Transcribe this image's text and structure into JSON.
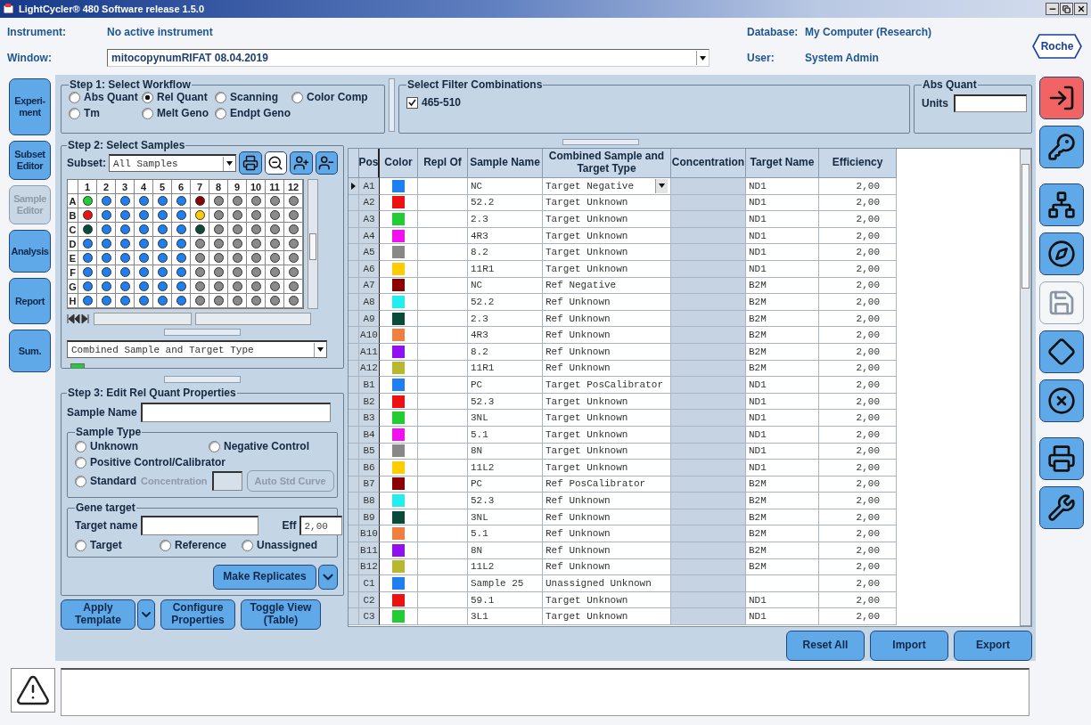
{
  "title_bar": {
    "title": "LightCycler® 480 Software release 1.5.0"
  },
  "header": {
    "instrument": {
      "label": "Instrument:",
      "value": "No active instrument"
    },
    "database": {
      "label": "Database:",
      "value": "My Computer (Research)"
    },
    "window": {
      "label": "Window:",
      "value": "mitocopynumRIFAT 08.04.2019"
    },
    "user": {
      "label": "User:",
      "value": "System Admin"
    },
    "logo": "Roche"
  },
  "left_nav": [
    {
      "label": "Experi-\nment",
      "disabled": false
    },
    {
      "label": "Subset\nEditor",
      "disabled": false
    },
    {
      "label": "Sample\nEditor",
      "disabled": true
    },
    {
      "label": "Analysis",
      "disabled": false
    },
    {
      "label": "Report",
      "disabled": false
    },
    {
      "label": "Sum.",
      "disabled": false
    }
  ],
  "step1": {
    "title": "Step 1: Select Workflow",
    "options": [
      {
        "label": "Abs Quant",
        "selected": false
      },
      {
        "label": "Rel Quant",
        "selected": true
      },
      {
        "label": "Scanning",
        "selected": false
      },
      {
        "label": "Color Comp",
        "selected": false
      },
      {
        "label": "Tm",
        "selected": false
      },
      {
        "label": "Melt Geno",
        "selected": false
      },
      {
        "label": "Endpt Geno",
        "selected": false
      }
    ]
  },
  "filters": {
    "title": "Select Filter Combinations",
    "items": [
      {
        "label": "465-510",
        "checked": true
      }
    ]
  },
  "abs_quant": {
    "title": "Abs Quant",
    "units_label": "Units"
  },
  "step2": {
    "title": "Step 2: Select Samples",
    "subset_label": "Subset:",
    "subset_value": "All Samples",
    "tools": [
      {
        "kind": "print",
        "pressed": false
      },
      {
        "kind": "zoom_out",
        "pressed": true
      },
      {
        "kind": "add_user",
        "pressed": false
      },
      {
        "kind": "remove_user",
        "pressed": false
      }
    ],
    "plate": {
      "columns": [
        "1",
        "2",
        "3",
        "4",
        "5",
        "6",
        "7",
        "8",
        "9",
        "10",
        "11",
        "12"
      ],
      "rows": [
        {
          "label": "A",
          "wells": [
            {
              "color": "#22cc33"
            },
            {
              "color": "#1e7ff0"
            },
            {
              "color": "#1e7ff0"
            },
            {
              "color": "#1e7ff0"
            },
            {
              "color": "#1e7ff0"
            },
            {
              "color": "#1e7ff0"
            },
            {
              "color": "#8b0000"
            },
            {
              "color": "#8a8a8a"
            },
            {
              "color": "#8a8a8a"
            },
            {
              "color": "#8a8a8a"
            },
            {
              "color": "#8a8a8a"
            },
            {
              "color": "#8a8a8a"
            }
          ]
        },
        {
          "label": "B",
          "wells": [
            {
              "color": "#ee1111"
            },
            {
              "color": "#1e7ff0"
            },
            {
              "color": "#1e7ff0"
            },
            {
              "color": "#1e7ff0"
            },
            {
              "color": "#1e7ff0"
            },
            {
              "color": "#1e7ff0"
            },
            {
              "color": "#ffcc00"
            },
            {
              "color": "#8a8a8a"
            },
            {
              "color": "#8a8a8a"
            },
            {
              "color": "#8a8a8a"
            },
            {
              "color": "#8a8a8a"
            },
            {
              "color": "#8a8a8a"
            }
          ]
        },
        {
          "label": "C",
          "wells": [
            {
              "color": "#0a4a3a"
            },
            {
              "color": "#1e7ff0"
            },
            {
              "color": "#1e7ff0"
            },
            {
              "color": "#1e7ff0"
            },
            {
              "color": "#1e7ff0"
            },
            {
              "color": "#1e7ff0"
            },
            {
              "color": "#0a4a3a"
            },
            {
              "color": "#8a8a8a"
            },
            {
              "color": "#8a8a8a"
            },
            {
              "color": "#8a8a8a"
            },
            {
              "color": "#8a8a8a"
            },
            {
              "color": "#8a8a8a"
            }
          ]
        },
        {
          "label": "D",
          "wells": [
            {
              "color": "#1e7ff0"
            },
            {
              "color": "#1e7ff0"
            },
            {
              "color": "#1e7ff0"
            },
            {
              "color": "#1e7ff0"
            },
            {
              "color": "#1e7ff0"
            },
            {
              "color": "#1e7ff0"
            },
            {
              "color": "#8a8a8a"
            },
            {
              "color": "#8a8a8a"
            },
            {
              "color": "#8a8a8a"
            },
            {
              "color": "#8a8a8a"
            },
            {
              "color": "#8a8a8a"
            },
            {
              "color": "#8a8a8a"
            }
          ]
        },
        {
          "label": "E",
          "wells": [
            {
              "color": "#1e7ff0"
            },
            {
              "color": "#1e7ff0"
            },
            {
              "color": "#1e7ff0"
            },
            {
              "color": "#1e7ff0"
            },
            {
              "color": "#1e7ff0"
            },
            {
              "color": "#1e7ff0"
            },
            {
              "color": "#8a8a8a"
            },
            {
              "color": "#8a8a8a"
            },
            {
              "color": "#8a8a8a"
            },
            {
              "color": "#8a8a8a"
            },
            {
              "color": "#8a8a8a"
            },
            {
              "color": "#8a8a8a"
            }
          ]
        },
        {
          "label": "F",
          "wells": [
            {
              "color": "#1e7ff0"
            },
            {
              "color": "#1e7ff0"
            },
            {
              "color": "#1e7ff0"
            },
            {
              "color": "#1e7ff0"
            },
            {
              "color": "#1e7ff0"
            },
            {
              "color": "#1e7ff0"
            },
            {
              "color": "#8a8a8a"
            },
            {
              "color": "#8a8a8a"
            },
            {
              "color": "#8a8a8a"
            },
            {
              "color": "#8a8a8a"
            },
            {
              "color": "#8a8a8a"
            },
            {
              "color": "#8a8a8a"
            }
          ]
        },
        {
          "label": "G",
          "wells": [
            {
              "color": "#1e7ff0"
            },
            {
              "color": "#1e7ff0"
            },
            {
              "color": "#1e7ff0"
            },
            {
              "color": "#1e7ff0"
            },
            {
              "color": "#1e7ff0"
            },
            {
              "color": "#1e7ff0"
            },
            {
              "color": "#8a8a8a"
            },
            {
              "color": "#8a8a8a"
            },
            {
              "color": "#8a8a8a"
            },
            {
              "color": "#8a8a8a"
            },
            {
              "color": "#8a8a8a"
            },
            {
              "color": "#8a8a8a"
            }
          ]
        },
        {
          "label": "H",
          "wells": [
            {
              "color": "#1e7ff0"
            },
            {
              "color": "#1e7ff0"
            },
            {
              "color": "#1e7ff0"
            },
            {
              "color": "#1e7ff0"
            },
            {
              "color": "#1e7ff0"
            },
            {
              "color": "#1e7ff0"
            },
            {
              "color": "#8a8a8a"
            },
            {
              "color": "#8a8a8a"
            },
            {
              "color": "#8a8a8a"
            },
            {
              "color": "#8a8a8a"
            },
            {
              "color": "#8a8a8a"
            },
            {
              "color": "#8a8a8a"
            }
          ]
        }
      ]
    },
    "display_select": "Combined Sample and Target Type",
    "legend": [
      {
        "color": "#22cc33"
      }
    ]
  },
  "step3": {
    "title": "Step 3: Edit Rel Quant Properties",
    "sample_name_label": "Sample Name",
    "sample_type": {
      "title": "Sample Type",
      "options": [
        {
          "label": "Unknown",
          "selected": false
        },
        {
          "label": "Negative Control",
          "selected": false
        },
        {
          "label": "Positive Control/Calibrator",
          "selected": false
        },
        {
          "label": "Standard",
          "selected": false
        }
      ],
      "concentration_label": "Concentration",
      "auto_button": "Auto Std Curve",
      "concentration_disabled": true
    },
    "gene_target": {
      "title": "Gene target",
      "target_label": "Target name",
      "eff_label": "Eff",
      "eff_value": "2,00",
      "options": [
        {
          "label": "Target",
          "selected": false
        },
        {
          "label": "Reference",
          "selected": false
        },
        {
          "label": "Unassigned",
          "selected": false
        }
      ]
    },
    "replicates_button": "Make Replicates"
  },
  "left_buttons": [
    {
      "label": "Apply\nTemplate",
      "kind": "split"
    },
    {
      "label": "Configure\nProperties",
      "kind": "plain"
    },
    {
      "label": "Toggle View\n(Table)",
      "kind": "plain"
    }
  ],
  "table": {
    "columns": [
      "Pos",
      "Color",
      "Repl Of",
      "Sample Name",
      "Combined Sample and Target Type",
      "Concentration",
      "Target Name",
      "Efficiency"
    ],
    "rows": [
      {
        "pos": "A1",
        "color": "#1e7ff0",
        "sample_name": "NC",
        "type": "Target Negative",
        "target": "ND1",
        "efficiency": "2,00",
        "selected": true
      },
      {
        "pos": "A2",
        "color": "#ee1111",
        "sample_name": "52.2",
        "type": "Target Unknown",
        "target": "ND1",
        "efficiency": "2,00",
        "selected": false
      },
      {
        "pos": "A3",
        "color": "#22cc33",
        "sample_name": "2.3",
        "type": "Target Unknown",
        "target": "ND1",
        "efficiency": "2,00",
        "selected": false
      },
      {
        "pos": "A4",
        "color": "#f010f0",
        "sample_name": "4R3",
        "type": "Target Unknown",
        "target": "ND1",
        "efficiency": "2,00",
        "selected": false
      },
      {
        "pos": "A5",
        "color": "#888888",
        "sample_name": "8.2",
        "type": "Target Unknown",
        "target": "ND1",
        "efficiency": "2,00",
        "selected": false
      },
      {
        "pos": "A6",
        "color": "#ffcc00",
        "sample_name": "11R1",
        "type": "Target Unknown",
        "target": "ND1",
        "efficiency": "2,00",
        "selected": false
      },
      {
        "pos": "A7",
        "color": "#8b0000",
        "sample_name": "NC",
        "type": "Ref Negative",
        "target": "B2M",
        "efficiency": "2,00",
        "selected": false
      },
      {
        "pos": "A8",
        "color": "#22eeee",
        "sample_name": "52.2",
        "type": "Ref Unknown",
        "target": "B2M",
        "efficiency": "2,00",
        "selected": false
      },
      {
        "pos": "A9",
        "color": "#0a4a3a",
        "sample_name": "2.3",
        "type": "Ref Unknown",
        "target": "B2M",
        "efficiency": "2,00",
        "selected": false
      },
      {
        "pos": "A10",
        "color": "#f08040",
        "sample_name": "4R3",
        "type": "Ref Unknown",
        "target": "B2M",
        "efficiency": "2,00",
        "selected": false
      },
      {
        "pos": "A11",
        "color": "#9010f0",
        "sample_name": "8.2",
        "type": "Ref Unknown",
        "target": "B2M",
        "efficiency": "2,00",
        "selected": false
      },
      {
        "pos": "A12",
        "color": "#b8b830",
        "sample_name": "11R1",
        "type": "Ref Unknown",
        "target": "B2M",
        "efficiency": "2,00",
        "selected": false
      },
      {
        "pos": "B1",
        "color": "#1e7ff0",
        "sample_name": "PC",
        "type": "Target PosCalibrator",
        "target": "ND1",
        "efficiency": "2,00",
        "selected": false
      },
      {
        "pos": "B2",
        "color": "#ee1111",
        "sample_name": "52.3",
        "type": "Target Unknown",
        "target": "ND1",
        "efficiency": "2,00",
        "selected": false
      },
      {
        "pos": "B3",
        "color": "#22cc33",
        "sample_name": "3NL",
        "type": "Target Unknown",
        "target": "ND1",
        "efficiency": "2,00",
        "selected": false
      },
      {
        "pos": "B4",
        "color": "#f010f0",
        "sample_name": "5.1",
        "type": "Target Unknown",
        "target": "ND1",
        "efficiency": "2,00",
        "selected": false
      },
      {
        "pos": "B5",
        "color": "#888888",
        "sample_name": "8N",
        "type": "Target Unknown",
        "target": "ND1",
        "efficiency": "2,00",
        "selected": false
      },
      {
        "pos": "B6",
        "color": "#ffcc00",
        "sample_name": "11L2",
        "type": "Target Unknown",
        "target": "ND1",
        "efficiency": "2,00",
        "selected": false
      },
      {
        "pos": "B7",
        "color": "#8b0000",
        "sample_name": "PC",
        "type": "Ref PosCalibrator",
        "target": "B2M",
        "efficiency": "2,00",
        "selected": false
      },
      {
        "pos": "B8",
        "color": "#22eeee",
        "sample_name": "52.3",
        "type": "Ref Unknown",
        "target": "B2M",
        "efficiency": "2,00",
        "selected": false
      },
      {
        "pos": "B9",
        "color": "#0a4a3a",
        "sample_name": "3NL",
        "type": "Ref Unknown",
        "target": "B2M",
        "efficiency": "2,00",
        "selected": false
      },
      {
        "pos": "B10",
        "color": "#f08040",
        "sample_name": "5.1",
        "type": "Ref Unknown",
        "target": "B2M",
        "efficiency": "2,00",
        "selected": false
      },
      {
        "pos": "B11",
        "color": "#9010f0",
        "sample_name": "8N",
        "type": "Ref Unknown",
        "target": "B2M",
        "efficiency": "2,00",
        "selected": false
      },
      {
        "pos": "B12",
        "color": "#b8b830",
        "sample_name": "11L2",
        "type": "Ref Unknown",
        "target": "B2M",
        "efficiency": "2,00",
        "selected": false
      },
      {
        "pos": "C1",
        "color": "#1e7ff0",
        "sample_name": "Sample 25",
        "type": "Unassigned Unknown",
        "efficiency": "2,00",
        "selected": false
      },
      {
        "pos": "C2",
        "color": "#ee1111",
        "sample_name": "59.1",
        "type": "Target Unknown",
        "target": "ND1",
        "efficiency": "2,00",
        "selected": false
      },
      {
        "pos": "C3",
        "color": "#22cc33",
        "sample_name": "3L1",
        "type": "Target Unknown",
        "target": "ND1",
        "efficiency": "2,00",
        "selected": false
      }
    ]
  },
  "right_buttons": [
    "Reset All",
    "Import",
    "Export"
  ],
  "toolbar": [
    {
      "kind": "exit",
      "disabled": false
    },
    {
      "kind": "key",
      "disabled": false
    },
    {
      "kind": "network",
      "disabled": false
    },
    {
      "kind": "compass",
      "disabled": false
    },
    {
      "kind": "save",
      "disabled": true
    },
    {
      "kind": "diamond",
      "disabled": false
    },
    {
      "kind": "cancel",
      "disabled": false
    },
    {
      "kind": "print",
      "disabled": false
    },
    {
      "kind": "tools",
      "disabled": false
    }
  ]
}
